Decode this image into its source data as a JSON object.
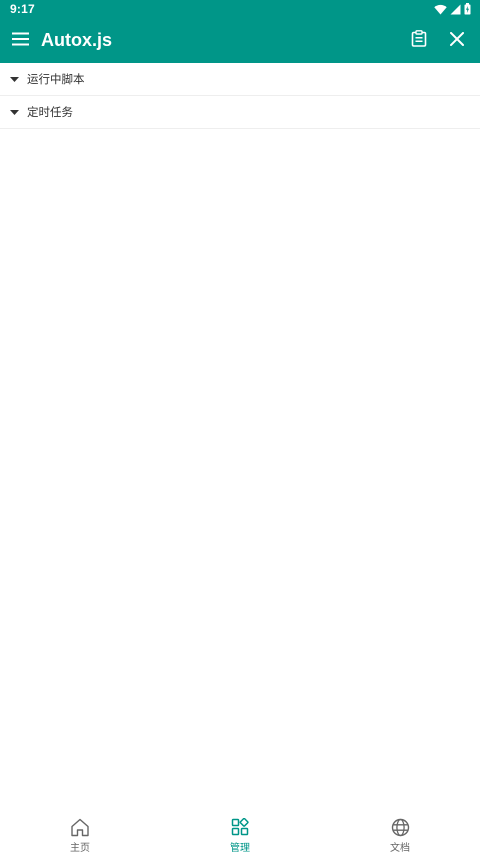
{
  "status_bar": {
    "time": "9:17",
    "icons": [
      "wifi-icon",
      "signal-icon",
      "battery-icon"
    ]
  },
  "toolbar": {
    "title": "Autox.js",
    "menu_icon": "menu-icon",
    "actions": [
      "clipboard-icon",
      "close-icon"
    ],
    "background": "#009688"
  },
  "sections": [
    {
      "label": "运行中脚本",
      "icon": "caret-down-icon"
    },
    {
      "label": "定时任务",
      "icon": "caret-down-icon"
    }
  ],
  "bottom_nav": {
    "items": [
      {
        "label": "主页",
        "icon": "home-icon",
        "active": false
      },
      {
        "label": "管理",
        "icon": "manage-icon",
        "active": true
      },
      {
        "label": "文档",
        "icon": "globe-icon",
        "active": false
      }
    ],
    "active_color": "#009688",
    "inactive_color": "#666666"
  }
}
